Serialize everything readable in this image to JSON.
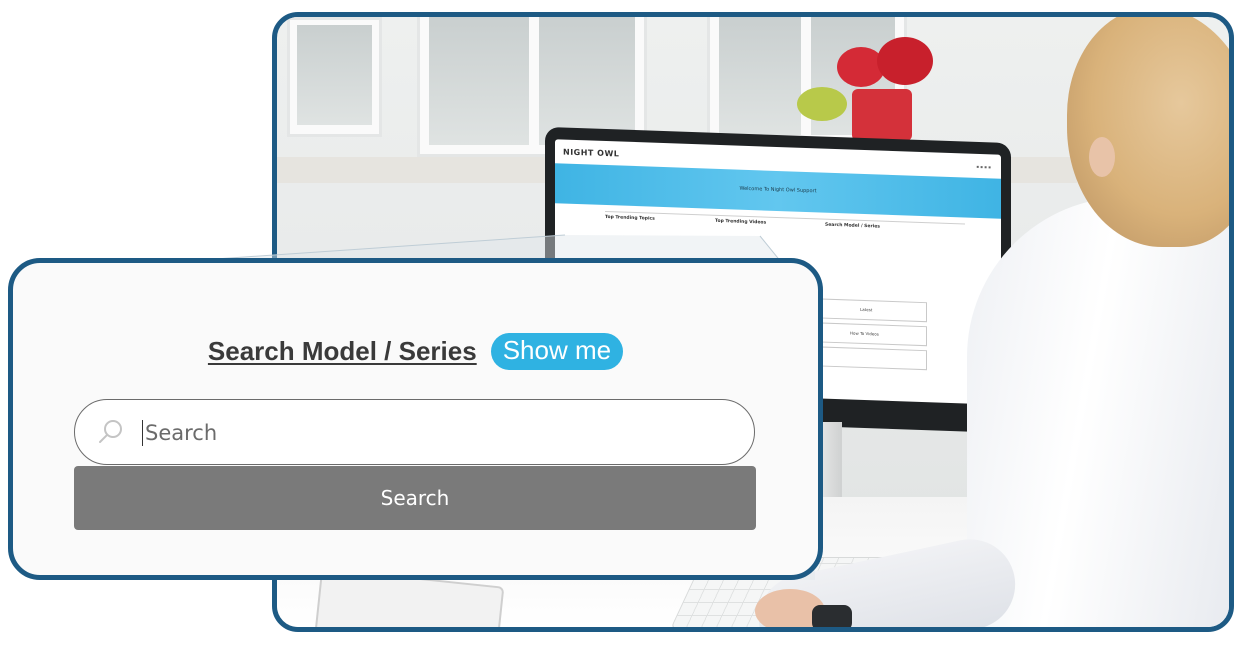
{
  "callout": {
    "heading": "Search Model / Series",
    "show_me_label": "Show me",
    "search_placeholder": "Search",
    "search_button_label": "Search"
  },
  "monitor_screen": {
    "logo_text": "NIGHT OWL",
    "banner_text": "Welcome To Night Owl Support",
    "column_titles": [
      "Top Trending Topics",
      "Top Trending Videos",
      "Search Model / Series"
    ],
    "box_labels": [
      "Latest",
      "How To Videos"
    ]
  },
  "colors": {
    "frame_border": "#1d5a84",
    "show_me_bg": "#2fb2e2",
    "search_button_bg": "#7a7a7a",
    "banner": "#3fb4e4"
  },
  "icons": {
    "search": "search-icon"
  }
}
